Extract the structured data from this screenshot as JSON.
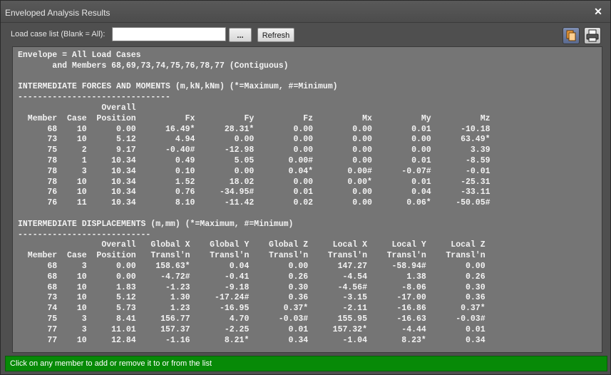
{
  "window": {
    "title": "Enveloped Analysis Results",
    "close_icon": "close-icon"
  },
  "toolbar": {
    "load_case_label": "Load case list (Blank = All):",
    "load_case_value": "",
    "browse_label": "...",
    "refresh_label": "Refresh",
    "copy_icon": "copy-icon",
    "print_icon": "printer-icon"
  },
  "report": {
    "lines": [
      "Envelope = All Load Cases",
      "       and Members 68,69,73,74,75,76,78,77 (Contiguous)",
      "",
      "INTERMEDIATE FORCES AND MOMENTS (m,kN,kNm) (*=Maximum, #=Minimum)",
      "-------------------------------",
      "                 Overall",
      "  Member  Case  Position          Fx          Fy          Fz          Mx          My          Mz",
      "      68    10      0.00      16.49*      28.31*        0.00        0.00        0.01      -10.18",
      "      73    10      5.12        4.94        0.00        0.00        0.00        0.00      63.49*",
      "      75     2      9.17      -0.40#      -12.98        0.00        0.00        0.00        3.39",
      "      78     1     10.34        0.49        5.05       0.00#        0.00        0.01       -8.59",
      "      78     3     10.34        0.10        0.00       0.04*       0.00#      -0.07#       -0.01",
      "      78    10     10.34        1.52       18.02        0.00       0.00*        0.01      -25.31",
      "      76    10     10.34        0.76     -34.95#        0.01        0.00        0.04      -33.11",
      "      76    11     10.34        8.10      -11.42        0.02        0.00       0.06*     -50.05#",
      "",
      "INTERMEDIATE DISPLACEMENTS (m,mm) (*=Maximum, #=Minimum)",
      "---------------------------",
      "                 Overall   Global X    Global Y    Global Z     Local X     Local Y     Local Z",
      "  Member  Case  Position   Transl'n    Transl'n    Transl'n    Transl'n    Transl'n    Transl'n",
      "      68     3      0.00    158.63*        0.04        0.00      147.27     -58.94#        0.00",
      "      68    10      0.00     -4.72#       -0.41        0.26       -4.54        1.38        0.26",
      "      68    10      1.83      -1.23       -9.18        0.30      -4.56#       -8.06        0.30",
      "      73    10      5.12       1.30     -17.24#        0.36       -3.15      -17.00        0.36",
      "      74    10      5.73       1.23      -16.95       0.37*       -2.11      -16.86       0.37*",
      "      75     3      8.41     156.77        4.70      -0.03#      155.95      -16.63      -0.03#",
      "      77     3     11.01     157.37       -2.25        0.01     157.32*       -4.44        0.01",
      "      77    10     12.84      -1.16       8.21*        0.34       -1.04       8.23*        0.34"
    ]
  },
  "status": {
    "text": "Click on any member to add or remove it to or from the list"
  }
}
